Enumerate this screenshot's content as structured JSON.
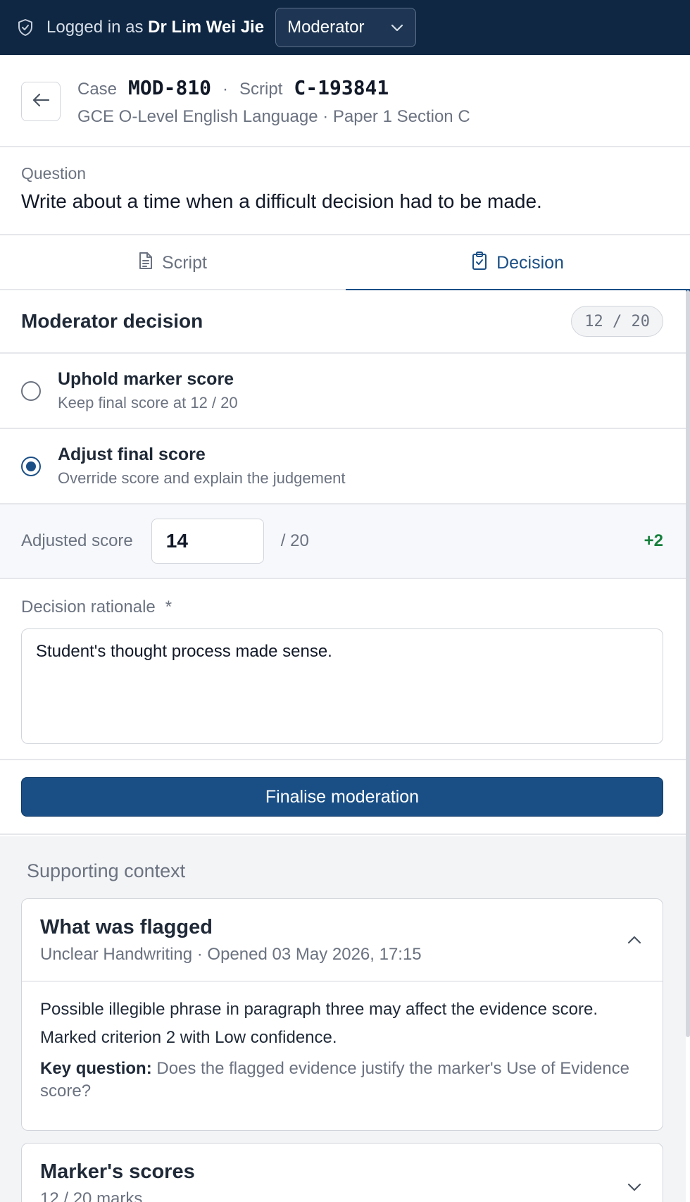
{
  "topbar": {
    "logged_prefix": "Logged in as",
    "user_name": "Dr Lim Wei Jie",
    "role": "Moderator"
  },
  "case": {
    "case_label": "Case",
    "case_id": "MOD-810",
    "script_label": "Script",
    "script_id": "C-193841",
    "separator": "·",
    "subtitle": "GCE O-Level English Language · Paper 1 Section C"
  },
  "question": {
    "label": "Question",
    "text": "Write about a time when a difficult decision had to be made."
  },
  "tabs": [
    {
      "label": "Script",
      "active": false
    },
    {
      "label": "Decision",
      "active": true
    }
  ],
  "decision": {
    "title": "Moderator decision",
    "score_badge": "12 / 20",
    "options": [
      {
        "title": "Uphold marker score",
        "subtitle": "Keep final score at 12 / 20",
        "selected": false
      },
      {
        "title": "Adjust final score",
        "subtitle": "Override score and explain the judgement",
        "selected": true
      }
    ],
    "adjusted_label": "Adjusted score",
    "adjusted_value": "14",
    "adjusted_max": "/ 20",
    "delta": "+2",
    "rationale_label": "Decision rationale",
    "rationale_required": "*",
    "rationale_text": "Student's thought process made sense.",
    "finalise_label": "Finalise moderation"
  },
  "context": {
    "heading": "Supporting context",
    "flagged": {
      "title": "What was flagged",
      "subtitle": "Unclear Handwriting · Opened 03 May 2026, 17:15",
      "body_line1": "Possible illegible phrase in paragraph three may affect the evidence score.",
      "body_line2": "Marked criterion 2 with Low confidence.",
      "key_label": "Key question:",
      "key_text": "Does the flagged evidence justify the marker's Use of Evidence score?"
    },
    "scores": {
      "title": "Marker's scores",
      "subtitle": "12 / 20 marks"
    }
  },
  "colors": {
    "topbar_bg": "#0f2743",
    "accent": "#1a4f86",
    "delta_green": "#16803c"
  },
  "icons": [
    "shield-check-icon",
    "chevron-down-icon",
    "arrow-left-icon",
    "document-icon",
    "clipboard-check-icon",
    "chevron-up-icon"
  ]
}
